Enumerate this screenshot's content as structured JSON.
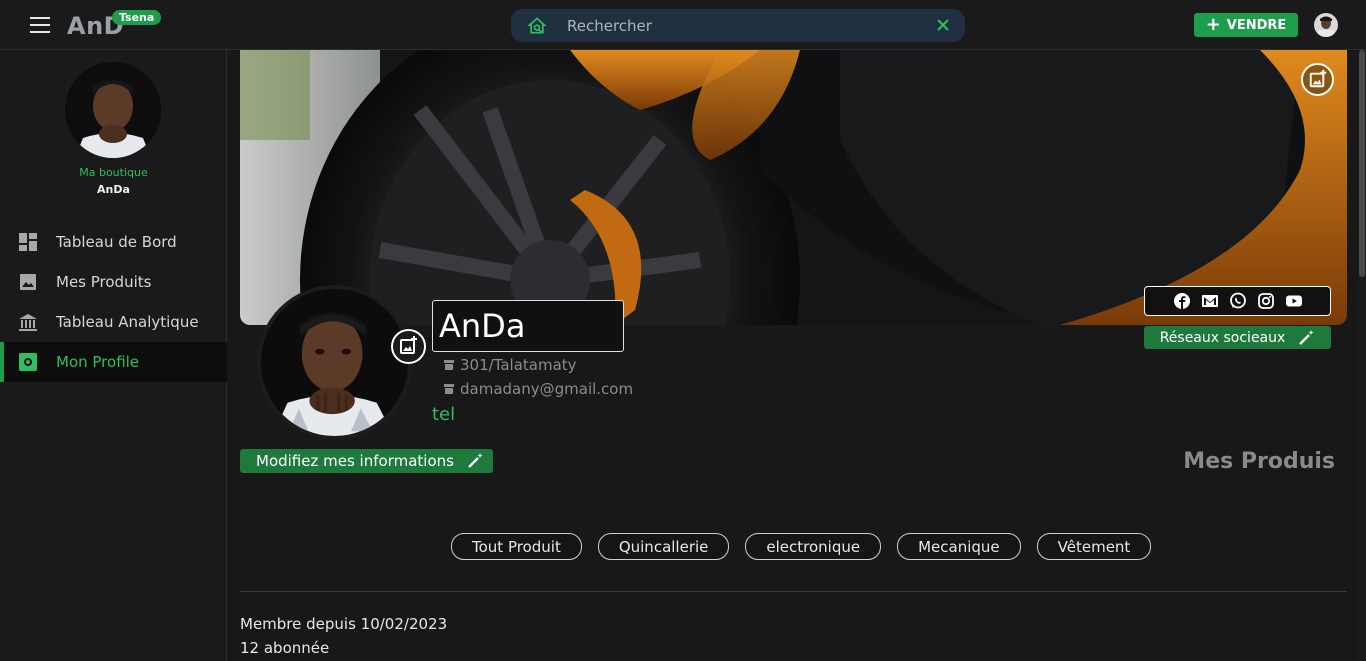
{
  "header": {
    "logo_text": "AnDa",
    "logo_badge": "Tsena",
    "search_placeholder": "Rechercher",
    "sell_label": "VENDRE"
  },
  "sidebar": {
    "shop_label": "Ma boutique",
    "shop_name": "AnDa",
    "items": [
      {
        "label": "Tableau de Bord",
        "icon": "dashboard-icon"
      },
      {
        "label": "Mes Produits",
        "icon": "image-icon"
      },
      {
        "label": "Tableau Analytique",
        "icon": "bank-icon"
      },
      {
        "label": "Mon Profile",
        "icon": "settings-icon",
        "active": true
      }
    ]
  },
  "profile": {
    "name": "AnDa",
    "address": "301/Talatamaty",
    "email": "damadany@gmail.com",
    "tel": "tel",
    "edit_info_label": "Modifiez mes informations",
    "socials_label": "Réseaux socieaux",
    "socials": [
      "facebook-icon",
      "gmail-icon",
      "whatsapp-icon",
      "instagram-icon",
      "youtube-icon"
    ],
    "member_since": "Membre depuis 10/02/2023",
    "followers": "12 abonnée"
  },
  "products": {
    "title": "Mes Produis",
    "categories": [
      "Tout Produit",
      "Quincallerie",
      "electronique",
      "Mecanique",
      "Vêtement"
    ]
  },
  "colors": {
    "accent": "#1e9e4a",
    "accent_text": "#2fbf5f",
    "background": "#181818",
    "search_bg": "#213040"
  }
}
